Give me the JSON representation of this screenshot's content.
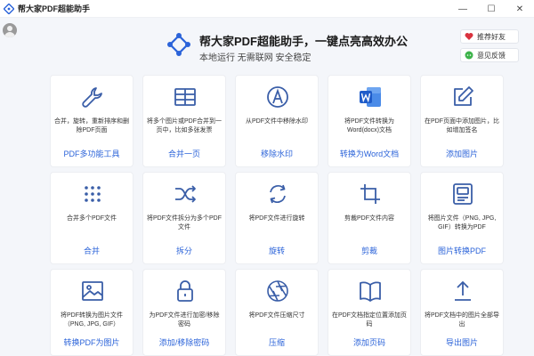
{
  "window": {
    "title": "帮大家PDF超能助手",
    "minimize": "—",
    "maximize": "☐",
    "close": "✕"
  },
  "header": {
    "title": "帮大家PDF超能助手，一键点亮高效办公",
    "subtitle": "本地运行 无需联网 安全稳定",
    "recommend_label": "推荐好友",
    "feedback_label": "意见反馈"
  },
  "colors": {
    "accent": "#2b63d9",
    "icon": "#3a5ea8",
    "word_blue": "#1f5cc9",
    "heart": "#d9333f",
    "wechat": "#3db34a"
  },
  "tools": [
    {
      "icon": "wrench-icon",
      "desc": "合并，旋转，重新排序和删除PDF页面",
      "label": "PDF多功能工具"
    },
    {
      "icon": "grid-icon",
      "desc": "将多个图片或PDF合并到一页中，比如多张发票",
      "label": "合并一页"
    },
    {
      "icon": "watermark-icon",
      "desc": "从PDF文件中移除水印",
      "label": "移除水印"
    },
    {
      "icon": "word-icon",
      "desc": "将PDF文件转换为Word(docx)文档",
      "label": "转换为Word文档"
    },
    {
      "icon": "edit-icon",
      "desc": "在PDF页面中添加图片，比如增加签名",
      "label": "添加图片"
    },
    {
      "icon": "dots-grid-icon",
      "desc": "合并多个PDF文件",
      "label": "合并"
    },
    {
      "icon": "shuffle-icon",
      "desc": "将PDF文件拆分为多个PDF文件",
      "label": "拆分"
    },
    {
      "icon": "rotate-icon",
      "desc": "将PDF文件进行旋转",
      "label": "旋转"
    },
    {
      "icon": "crop-icon",
      "desc": "剪裁PDF文件内容",
      "label": "剪裁"
    },
    {
      "icon": "id-card-icon",
      "desc": "将图片文件（PNG, JPG, GIF）转换为PDF",
      "label": "图片转换PDF"
    },
    {
      "icon": "image-icon",
      "desc": "将PDF转换为图片文件（PNG, JPG, GIF）",
      "label": "转换PDF为图片"
    },
    {
      "icon": "lock-icon",
      "desc": "为PDF文件进行加密/移除密码",
      "label": "添加/移除密码"
    },
    {
      "icon": "aperture-icon",
      "desc": "将PDF文件压缩尺寸",
      "label": "压缩"
    },
    {
      "icon": "book-icon",
      "desc": "在PDF文档指定位置添加页码",
      "label": "添加页码"
    },
    {
      "icon": "upload-icon",
      "desc": "将PDF文档中的图片全部导出",
      "label": "导出图片"
    }
  ]
}
